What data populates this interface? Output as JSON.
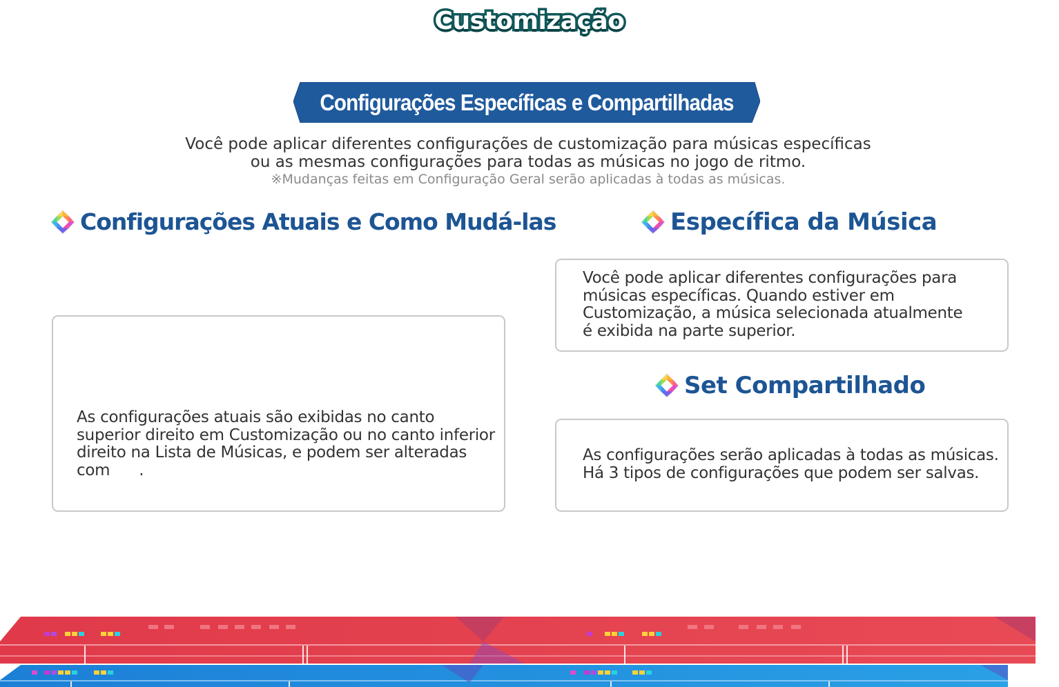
{
  "page": {
    "title": "Customização"
  },
  "banner": {
    "title": "Configurações Específicas e Compartilhadas",
    "color": "#1f5a9c"
  },
  "intro": {
    "line1": "Você pode aplicar diferentes configurações de customização para músicas específicas",
    "line2": "ou as mesmas configurações para todas as músicas no jogo de ritmo.",
    "note": "※Mudanças feitas em Configuração Geral serão aplicadas à todas as músicas."
  },
  "sections": {
    "current": {
      "heading": "Configurações Atuais e Como Mudá-las",
      "icon": "gem-icon",
      "text": {
        "line1": "As configurações atuais são exibidas no canto",
        "line2": "superior direito em Customização ou no canto inferior",
        "line3": "direito na Lista de Músicas, e podem ser alteradas",
        "line4_start": "com",
        "line4_end": "."
      }
    },
    "specific": {
      "heading": "Específica da Música",
      "icon": "gem-icon",
      "text": {
        "line1": "Você pode aplicar diferentes configurações para",
        "line2": "músicas específicas. Quando estiver em",
        "line3": "Customização, a música selecionada atualmente",
        "line4": "é exibida na parte superior."
      }
    },
    "shared": {
      "heading": "Set Compartilhado",
      "icon": "gem-icon",
      "text": {
        "line1": "As configurações serão aplicadas à todas as músicas.",
        "line2": "Há 3 tipos de configurações que podem ser salvas."
      }
    }
  },
  "colors": {
    "heading": "#1d5594",
    "title_outline": "#10585a",
    "stripe_red": "#e2434f",
    "stripe_blue": "#1e8fdc"
  }
}
